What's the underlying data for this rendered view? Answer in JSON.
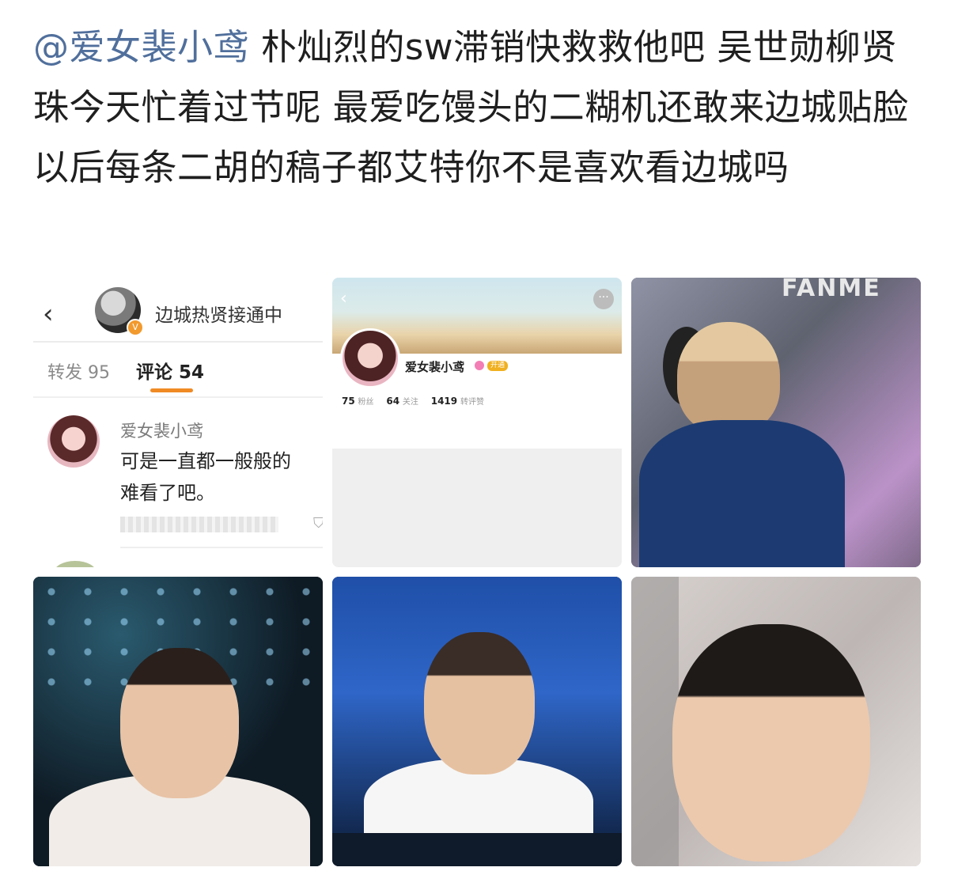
{
  "post": {
    "mention": "@爱女裴小鸢",
    "text": " 朴灿烈的sw滞销快救救他吧 吴世勋柳贤珠今天忙着过节呢 最爱吃馒头的二糊机还敢来边城贴脸 以后每条二胡的稿子都艾特你不是喜欢看边城吗"
  },
  "tile1": {
    "back_icon": "chevron-left-icon",
    "header_name": "边城热贤接通中",
    "verified_icon": "v-badge-icon",
    "tab_repost_label": "转发 95",
    "tab_comment_label": "评论 54",
    "comment": {
      "author": "爱女裴小鸢",
      "text_line1": "可是一直都一般般的",
      "text_line2": "难看了吧。"
    }
  },
  "tile2": {
    "back_icon": "chevron-left-icon",
    "more_icon": "more-dots-icon",
    "name": "爱女裴小鸢",
    "vip_label": "开通",
    "followers_count": "75",
    "followers_label": "粉丝",
    "following_count": "64",
    "following_label": "关注",
    "likes_count": "1419",
    "likes_label": "转评赞"
  },
  "tile3": {
    "logo_text": "FANME"
  },
  "colors": {
    "mention": "#506f9c",
    "accent": "#f08a24",
    "text": "#1f1f1f"
  }
}
